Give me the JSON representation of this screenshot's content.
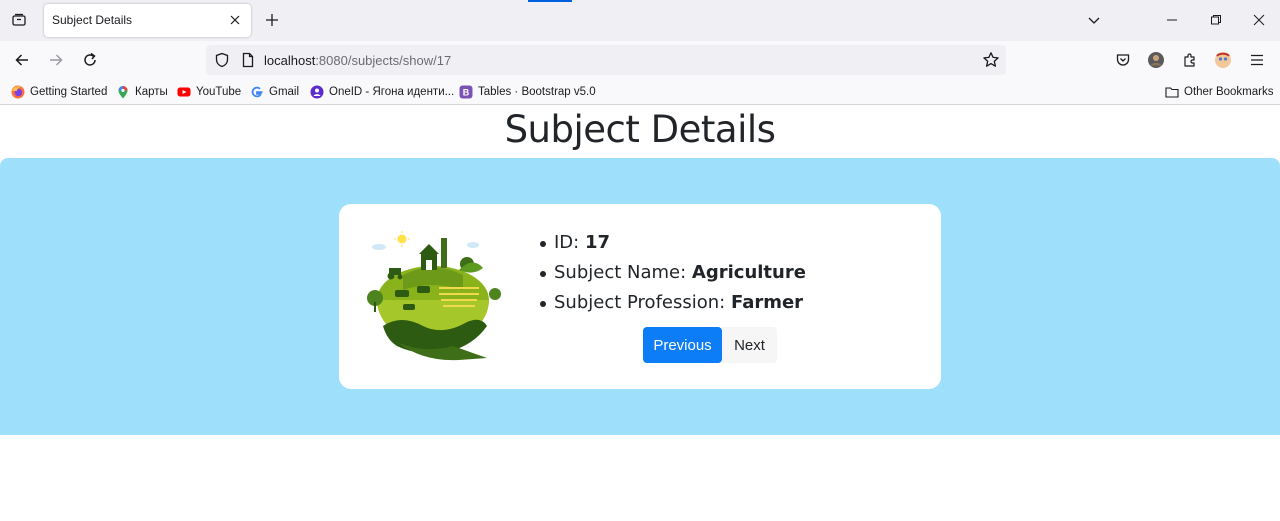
{
  "browser": {
    "tab_title": "Subject Details",
    "url_host": "localhost",
    "url_rest": ":8080/subjects/show/17",
    "bookmarks": [
      {
        "label": "Getting Started",
        "icon": "firefox-icon"
      },
      {
        "label": "Карты",
        "icon": "maps-pin-icon"
      },
      {
        "label": "YouTube",
        "icon": "youtube-icon"
      },
      {
        "label": "Gmail",
        "icon": "google-icon"
      },
      {
        "label": "OneID - Ягона иденти...",
        "icon": "oneid-icon"
      },
      {
        "label": "Tables · Bootstrap v5.0",
        "icon": "bootstrap-icon"
      }
    ],
    "other_bookmarks": "Other Bookmarks"
  },
  "page": {
    "title": "Subject Details",
    "fields": [
      {
        "label": "ID: ",
        "value": "17"
      },
      {
        "label": "Subject Name: ",
        "value": "Agriculture"
      },
      {
        "label": "Subject Profession: ",
        "value": "Farmer"
      }
    ],
    "previous_label": "Previous",
    "next_label": "Next"
  },
  "colors": {
    "hero_background": "#9ee0fc",
    "primary_button": "#0d7cf7",
    "card_background": "#ffffff"
  }
}
